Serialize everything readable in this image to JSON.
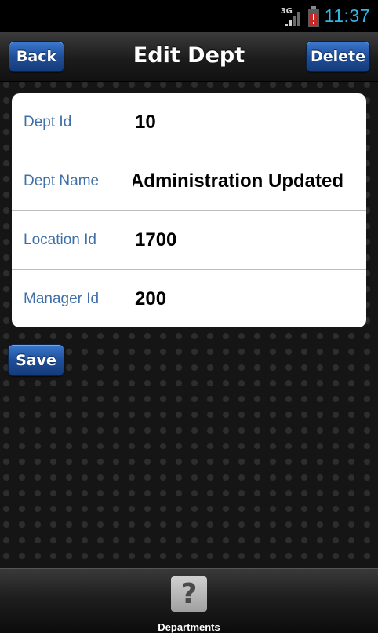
{
  "status_bar": {
    "network": "3G",
    "time": "11:37",
    "signal_icon": "signal-strength-icon",
    "battery_icon": "battery-alert-icon"
  },
  "navbar": {
    "title": "Edit Dept",
    "back_label": "Back",
    "delete_label": "Delete"
  },
  "form": {
    "fields": [
      {
        "label": "Dept Id",
        "value": "10"
      },
      {
        "label": "Dept Name",
        "value": "Administration Updated"
      },
      {
        "label": "Location Id",
        "value": "1700"
      },
      {
        "label": "Manager Id",
        "value": "200"
      }
    ]
  },
  "actions": {
    "save_label": "Save"
  },
  "tab_bar": {
    "items": [
      {
        "label": "Departments",
        "icon": "question-mark-icon",
        "glyph": "?"
      }
    ]
  },
  "colors": {
    "accent": "#33b5e5",
    "button_blue": "#1f4f9a",
    "label_blue": "#3f6fa8"
  }
}
